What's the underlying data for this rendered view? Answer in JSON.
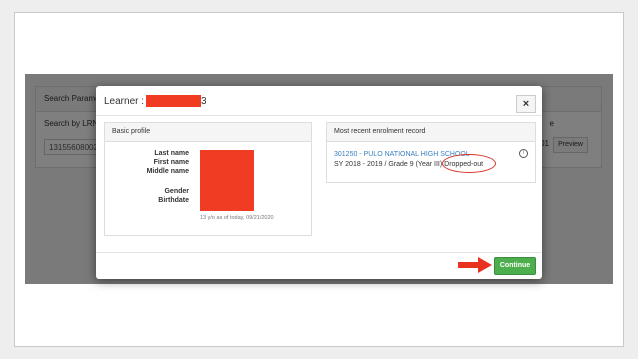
{
  "background": {
    "panel_title": "Search Paramete",
    "search_label": "Search by LRN",
    "search_value": "13155608002",
    "column_header": "e",
    "cell_value": "01",
    "preview_label": "Preview"
  },
  "modal": {
    "title_prefix": "Learner :",
    "title_suffix": "3",
    "close_label": "×",
    "profile": {
      "heading": "Basic profile",
      "fields": [
        "Last name",
        "First name",
        "Middle name",
        "Gender",
        "Birthdate"
      ],
      "age_note": "13 y/o as of today, 09/21/2020"
    },
    "enrolment": {
      "heading": "Most recent enrolment record",
      "school": "301250 - PULO NATIONAL HIGH SCHOOL",
      "sy_line": "SY 2018 - 2019 / Grade 9 (Year III)",
      "status": "Dropped-out",
      "info_icon": "i"
    },
    "continue_label": "Continue"
  },
  "colors": {
    "redaction": "#f03c23",
    "highlight": "#d9342b",
    "continue": "#4cae4c",
    "link": "#3a7fc0"
  }
}
